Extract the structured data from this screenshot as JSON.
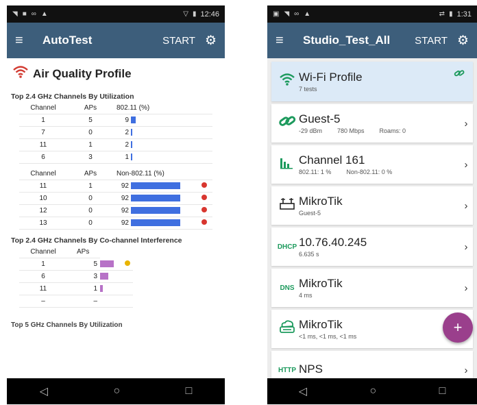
{
  "left": {
    "status": {
      "time": "12:46"
    },
    "appbar": {
      "title": "AutoTest",
      "start": "START"
    },
    "header": "Air Quality Profile",
    "sec1": {
      "title": "Top 2.4 GHz Channels By Utilization",
      "cols": [
        "Channel",
        "APs",
        "802.11 (%)"
      ],
      "rows": [
        {
          "ch": "1",
          "aps": "5",
          "val": "9",
          "pct": 9
        },
        {
          "ch": "7",
          "aps": "0",
          "val": "2",
          "pct": 2
        },
        {
          "ch": "11",
          "aps": "1",
          "val": "2",
          "pct": 2
        },
        {
          "ch": "6",
          "aps": "3",
          "val": "1",
          "pct": 1
        }
      ]
    },
    "sec2": {
      "cols": [
        "Channel",
        "APs",
        "Non-802.11 (%)"
      ],
      "rows": [
        {
          "ch": "11",
          "aps": "1",
          "val": "92",
          "pct": 92
        },
        {
          "ch": "10",
          "aps": "0",
          "val": "92",
          "pct": 92
        },
        {
          "ch": "12",
          "aps": "0",
          "val": "92",
          "pct": 92
        },
        {
          "ch": "13",
          "aps": "0",
          "val": "92",
          "pct": 92
        }
      ]
    },
    "sec3": {
      "title": "Top 2.4 GHz Channels By Co-channel Interference",
      "cols": [
        "Channel",
        "APs"
      ],
      "rows": [
        {
          "ch": "1",
          "aps": "5",
          "n": 5
        },
        {
          "ch": "6",
          "aps": "3",
          "n": 3
        },
        {
          "ch": "11",
          "aps": "1",
          "n": 1
        },
        {
          "ch": "–",
          "aps": "–",
          "n": 0
        }
      ]
    },
    "cut_title": "Top 5 GHz Channels By Utilization"
  },
  "right": {
    "status": {
      "time": "1:31"
    },
    "appbar": {
      "title": "Studio_Test_All",
      "start": "START"
    },
    "cards": [
      {
        "name": "Wi-Fi Profile",
        "sub": [
          "7 tests"
        ],
        "icon": "wifi-icon"
      },
      {
        "name": "Guest-5",
        "sub": [
          "-29 dBm",
          "780 Mbps",
          "Roams: 0"
        ],
        "icon": "link-icon"
      },
      {
        "name": "Channel  161",
        "sub": [
          "802.11: 1 %",
          "Non-802.11: 0 %"
        ],
        "icon": "bar-chart-icon"
      },
      {
        "name": "MikroTik",
        "sub": [
          "Guest-5"
        ],
        "icon": "access-point-icon"
      },
      {
        "name": "10.76.40.245",
        "sub": [
          "6.635 s"
        ],
        "icon": "dhcp-icon",
        "badge": "DHCP"
      },
      {
        "name": "MikroTik",
        "sub": [
          "4 ms"
        ],
        "icon": "dns-icon",
        "badge": "DNS"
      },
      {
        "name": "MikroTik",
        "sub": [
          "<1 ms,  <1 ms,  <1 ms"
        ],
        "icon": "cloud-icon"
      },
      {
        "name": "NPS",
        "sub": [
          ""
        ],
        "icon": "http-icon",
        "badge": "HTTP"
      }
    ],
    "fab": "+"
  },
  "colors": {
    "appbar": "#3d5e7b",
    "accent_green": "#1d9a5d",
    "bar_blue": "#3f6fe0",
    "bar_purple": "#b772c7",
    "dot_red": "#d8362f",
    "fab": "#9a3f8c"
  }
}
